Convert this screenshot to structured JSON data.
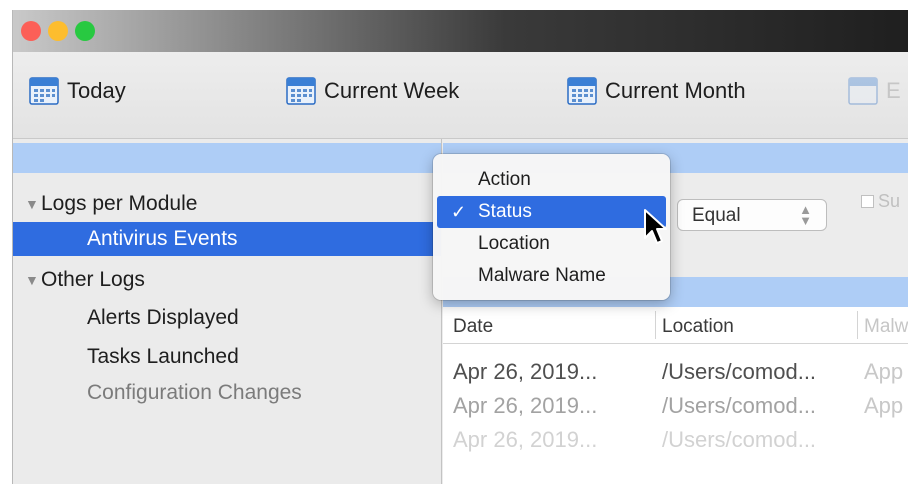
{
  "toolbar": {
    "items": [
      {
        "label": "Today",
        "icon": "calendar-icon"
      },
      {
        "label": "Current Week",
        "icon": "calendar-icon"
      },
      {
        "label": "Current Month",
        "icon": "calendar-icon"
      },
      {
        "label": "E",
        "icon": "calendar-icon"
      }
    ]
  },
  "sidebar": {
    "groups": [
      {
        "label": "Logs per Module",
        "items": [
          {
            "label": "Antivirus Events",
            "selected": true
          }
        ]
      },
      {
        "label": "Other Logs",
        "items": [
          {
            "label": "Alerts Displayed"
          },
          {
            "label": "Tasks Launched"
          },
          {
            "label": "Configuration Changes"
          }
        ]
      }
    ]
  },
  "filter": {
    "operator": "Equal",
    "checkbox_label": "Su"
  },
  "dropdown": {
    "options": [
      "Action",
      "Status",
      "Location",
      "Malware Name"
    ],
    "selected": "Status",
    "check_glyph": "✓"
  },
  "table": {
    "columns": [
      "Date",
      "Location",
      "Malw"
    ],
    "rows": [
      [
        "Apr 26, 2019...",
        "/Users/comod...",
        "App"
      ],
      [
        "Apr 26, 2019...",
        "/Users/comod...",
        "App"
      ],
      [
        "Apr 26, 2019...",
        "/Users/comod...",
        ""
      ]
    ]
  },
  "colors": {
    "selection": "#2f6ce0",
    "header_band": "#aecdf6",
    "close": "#fc5f57",
    "minimize": "#fdbd2e",
    "zoom": "#28c941"
  }
}
